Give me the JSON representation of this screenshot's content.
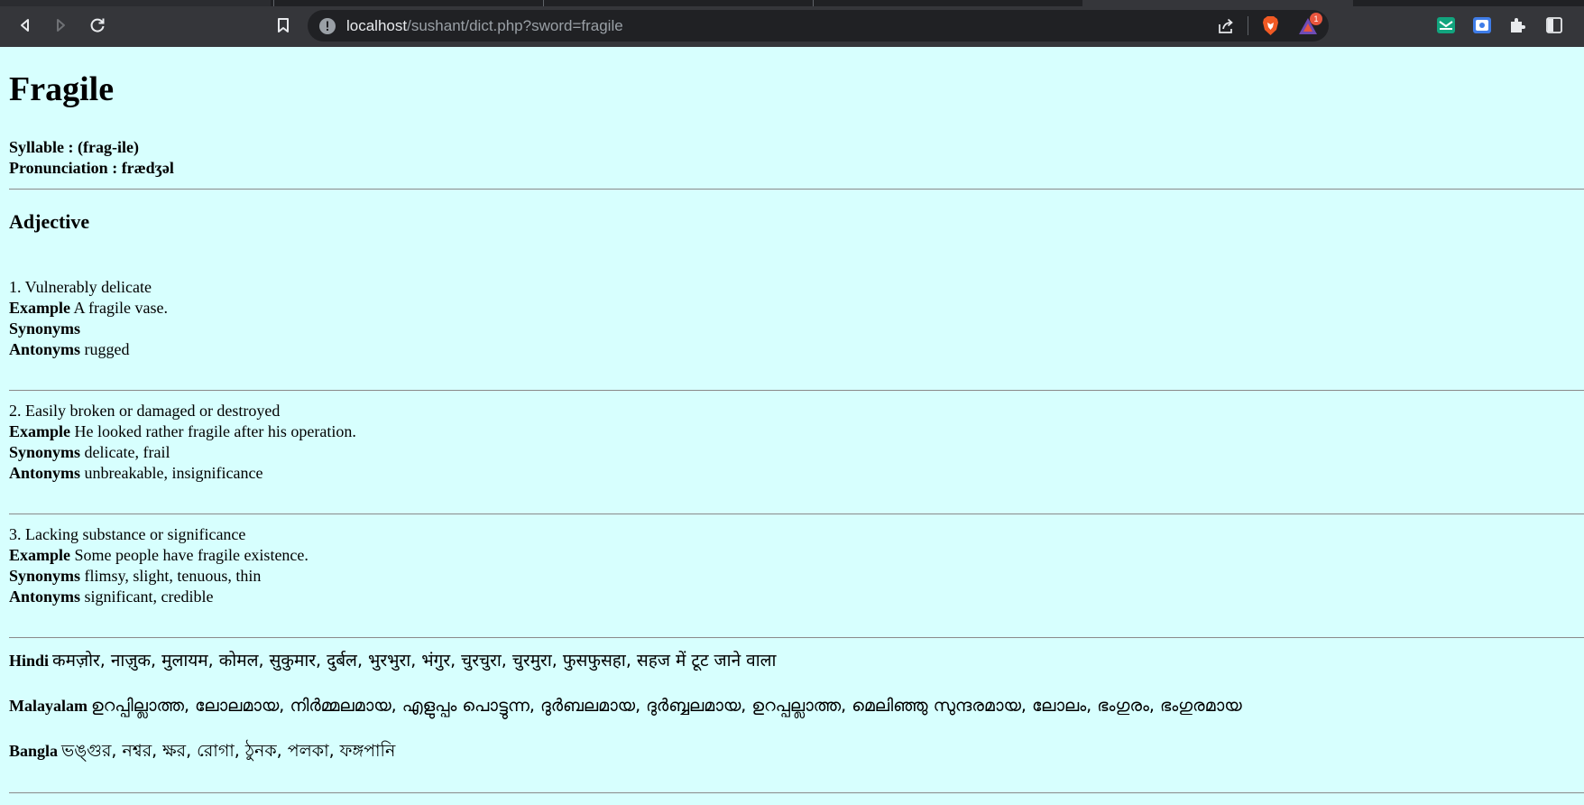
{
  "browser": {
    "url_host": "localhost",
    "url_path": "/sushant/dict.php?sword=fragile",
    "notification_count": "1"
  },
  "entry": {
    "word": "Fragile",
    "syllable_label": "Syllable :",
    "syllable": "(frag-ile)",
    "pronunciation_label": "Pronunciation :",
    "pronunciation": "frædʒəl",
    "part_of_speech": "Adjective",
    "example_label": "Example",
    "synonyms_label": "Synonyms",
    "antonyms_label": "Antonyms",
    "senses": [
      {
        "definition": "1. Vulnerably delicate",
        "example": "A fragile vase.",
        "synonyms": "",
        "antonyms": "rugged"
      },
      {
        "definition": "2. Easily broken or damaged or destroyed",
        "example": "He looked rather fragile after his operation.",
        "synonyms": "delicate, frail",
        "antonyms": "unbreakable, insignificance"
      },
      {
        "definition": "3. Lacking substance or significance",
        "example": "Some people have fragile existence.",
        "synonyms": "flimsy, slight, tenuous, thin",
        "antonyms": "significant, credible"
      }
    ],
    "translations": [
      {
        "language": "Hindi",
        "text": "कमज़ोर, नाज़ुक, मुलायम, कोमल, सुकुमार, दुर्बल, भुरभुरा, भंगुर, चुरचुरा, चुरमुरा, फुसफुसहा, सहज में टूट जाने वाला"
      },
      {
        "language": "Malayalam",
        "text": "ഉറപ്പില്ലാത്ത, ലോലമായ, നിർമ്മലമായ, എളുപ്പം പൊട്ടുന്ന, ദുർബലമായ, ദുർബ്ബലമായ, ഉറപ്പല്ലാത്ത, മെലിഞ്ഞു സുന്ദരമായ, ലോലം, ഭംഗുരം, ഭംഗുരമായ"
      },
      {
        "language": "Bangla",
        "text": "ভঙ্গুর, নশ্বর, ক্ষর, রোগা, ঠুনক, পলকা, ফঙ্গপানি"
      }
    ]
  },
  "colors": {
    "page_background": "#d7fffe",
    "chrome_background": "#35363a",
    "omnibox_background": "#202124",
    "rule": "#8a8a8a"
  },
  "icons": [
    "back-icon",
    "forward-icon",
    "reload-icon",
    "bookmark-icon",
    "site-info-icon",
    "share-icon",
    "brave-shield-icon",
    "brave-rewards-icon",
    "extension-mail-icon",
    "extension-screen-icon",
    "extensions-puzzle-icon",
    "sidebar-icon"
  ]
}
